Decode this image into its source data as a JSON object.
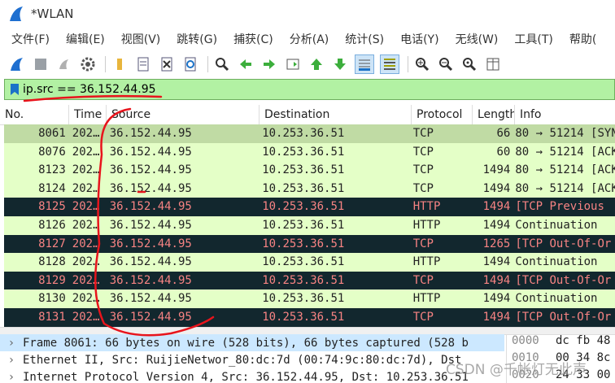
{
  "window": {
    "title": "*WLAN"
  },
  "menu": [
    "文件(F)",
    "编辑(E)",
    "视图(V)",
    "跳转(G)",
    "捕获(C)",
    "分析(A)",
    "统计(S)",
    "电话(Y)",
    "无线(W)",
    "工具(T)",
    "帮助("
  ],
  "toolbar": {
    "icons": [
      "shark-fin-icon",
      "stop-icon",
      "restart-icon",
      "options-gear-icon",
      "open-folder-icon",
      "save-file-icon",
      "close-file-icon",
      "reload-icon",
      "find-icon",
      "back-arrow-icon",
      "forward-arrow-icon",
      "goto-packet-icon",
      "first-packet-icon",
      "last-packet-icon",
      "autoscroll-icon",
      "colorize-icon",
      "zoom-in-icon",
      "zoom-out-icon",
      "zoom-normal-icon",
      "resize-columns-icon"
    ]
  },
  "filter": {
    "value": "ip.src == 36.152.44.95"
  },
  "columns": {
    "no": "No.",
    "time": "Time",
    "source": "Source",
    "destination": "Destination",
    "protocol": "Protocol",
    "length": "Length",
    "info": "Info"
  },
  "packets": [
    {
      "no": "8061",
      "time": "202…",
      "src": "36.152.44.95",
      "dst": "10.253.36.51",
      "proto": "TCP",
      "len": "66",
      "info": "80 → 51214 [SYN",
      "style": "selected"
    },
    {
      "no": "8076",
      "time": "202…",
      "src": "36.152.44.95",
      "dst": "10.253.36.51",
      "proto": "TCP",
      "len": "60",
      "info": "80 → 51214 [ACK",
      "style": "green"
    },
    {
      "no": "8123",
      "time": "202…",
      "src": "36.152.44.95",
      "dst": "10.253.36.51",
      "proto": "TCP",
      "len": "1494",
      "info": "80 → 51214 [ACK",
      "style": "green"
    },
    {
      "no": "8124",
      "time": "202…",
      "src": "36.152.44.95",
      "dst": "10.253.36.51",
      "proto": "TCP",
      "len": "1494",
      "info": "80 → 51214 [ACK",
      "style": "green"
    },
    {
      "no": "8125",
      "time": "202…",
      "src": "36.152.44.95",
      "dst": "10.253.36.51",
      "proto": "HTTP",
      "len": "1494",
      "info": "[TCP Previous",
      "style": "dark"
    },
    {
      "no": "8126",
      "time": "202…",
      "src": "36.152.44.95",
      "dst": "10.253.36.51",
      "proto": "HTTP",
      "len": "1494",
      "info": "Continuation",
      "style": "green"
    },
    {
      "no": "8127",
      "time": "202…",
      "src": "36.152.44.95",
      "dst": "10.253.36.51",
      "proto": "TCP",
      "len": "1265",
      "info": "[TCP Out-Of-Or",
      "style": "dark"
    },
    {
      "no": "8128",
      "time": "202…",
      "src": "36.152.44.95",
      "dst": "10.253.36.51",
      "proto": "HTTP",
      "len": "1494",
      "info": "Continuation",
      "style": "green"
    },
    {
      "no": "8129",
      "time": "202…",
      "src": "36.152.44.95",
      "dst": "10.253.36.51",
      "proto": "TCP",
      "len": "1494",
      "info": "[TCP Out-Of-Or",
      "style": "dark"
    },
    {
      "no": "8130",
      "time": "202…",
      "src": "36.152.44.95",
      "dst": "10.253.36.51",
      "proto": "HTTP",
      "len": "1494",
      "info": "Continuation",
      "style": "green"
    },
    {
      "no": "8131",
      "time": "202…",
      "src": "36.152.44.95",
      "dst": "10.253.36.51",
      "proto": "TCP",
      "len": "1494",
      "info": "[TCP Out-Of-Or",
      "style": "dark"
    }
  ],
  "details": [
    "Frame 8061: 66 bytes on wire (528 bits), 66 bytes captured (528 b",
    "Ethernet II, Src: RuijieNetwor_80:dc:7d (00:74:9c:80:dc:7d), Dst",
    "Internet Protocol Version 4, Src: 36.152.44.95, Dst: 10.253.36.51"
  ],
  "hex": [
    {
      "offset": "0000",
      "bytes": "dc fb 48"
    },
    {
      "offset": "0010",
      "bytes": "00 34 8c"
    },
    {
      "offset": "0020",
      "bytes": "24 33 00"
    }
  ],
  "watermark": "CSDN @千帐灯无此声",
  "colors": {
    "filter_bg": "#b2f1a3",
    "row_green": "#e4ffc7",
    "row_selected": "#c0dba4",
    "row_dark": "#12272e",
    "row_dark_text": "#f78383",
    "annotation": "#e8141c"
  }
}
